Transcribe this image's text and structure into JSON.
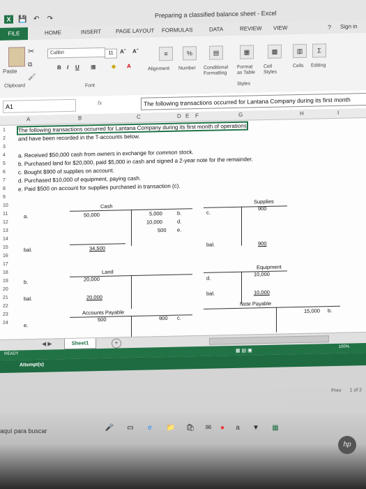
{
  "window": {
    "title": "Preparing a classified balance sheet - Excel",
    "help": "?"
  },
  "tabs": [
    "FILE",
    "HOME",
    "INSERT",
    "PAGE LAYOUT",
    "FORMULAS",
    "DATA",
    "REVIEW",
    "VIEW"
  ],
  "signin": "Sign in",
  "ribbon": {
    "paste": "Paste",
    "clipboard": "Clipboard",
    "font_name": "Calibri",
    "font_size": "11",
    "font_group": "Font",
    "bold": "B",
    "italic": "I",
    "underline": "U",
    "alignment": "Alignment",
    "number": "Number",
    "conditional": "Conditional Formatting",
    "format_table": "Format as Table",
    "cell_styles": "Cell Styles",
    "styles_group": "Styles",
    "cells": "Cells",
    "editing": "Editing"
  },
  "formula_bar": {
    "name_box": "A1",
    "fx": "fx",
    "content": "The following transactions occurred for Lantana Company during its first month"
  },
  "columns": [
    "A",
    "B",
    "C",
    "D",
    "E",
    "F",
    "G",
    "H",
    "I"
  ],
  "rows": [
    "1",
    "2",
    "3",
    "4",
    "5",
    "6",
    "7",
    "8",
    "9",
    "10",
    "11",
    "12",
    "13",
    "14",
    "15",
    "16",
    "17",
    "18",
    "19",
    "20",
    "21",
    "22",
    "23",
    "24"
  ],
  "sheet_text": {
    "r1": "The following transactions occurred for Lantana Company during its first month of operations",
    "r2": "and have been recorded in the T-accounts below.",
    "r4": "a. Received $50,000 cash from owners in exchange for common stock.",
    "r5": "b. Purchased land for $20,000, paid $5,000 in cash and signed a 2-year note for the remainder.",
    "r6": "c. Bought $900 of supplies on account.",
    "r7": "d. Purchased $10,000 of equipment, paying cash.",
    "r8": "e. Paid $500 on account for supplies purchased in transaction (c)."
  },
  "taccounts": {
    "cash_title": "Cash",
    "cash_a": "a.",
    "cash_debit": "50,000",
    "cash_credits": [
      "5,000",
      "10,000",
      "500"
    ],
    "cash_credit_keys": [
      "b.",
      "d.",
      "e."
    ],
    "cash_bal_lbl": "bal.",
    "cash_bal": "34,500",
    "supplies_title": "Supplies",
    "supplies_key": "c.",
    "supplies_val": "900",
    "supplies_bal_lbl": "bal.",
    "supplies_bal": "900",
    "land_title": "Land",
    "land_key": "b.",
    "land_val": "20,000",
    "land_bal_lbl": "bal.",
    "land_bal": "20,000",
    "equip_title": "Equipment",
    "equip_key": "d.",
    "equip_val": "10,000",
    "equip_bal_lbl": "bal.",
    "equip_bal": "10,000",
    "ap_title": "Accounts Payable",
    "ap_key": "e.",
    "ap_debit": "500",
    "ap_credit": "900",
    "ap_credit_key": "c.",
    "np_title": "Note Payable",
    "np_credit": "15,000",
    "np_key": "b."
  },
  "sheet_tab": "Sheet1",
  "sheet_add": "+",
  "status": "READY",
  "attempts": "Attempt(s)",
  "pager": "1 of 2",
  "prev": "Prev",
  "zoom": "100%",
  "taskbar": {
    "search": "aquí para buscar",
    "hp": "hp"
  },
  "colors": {
    "excel_green": "#217346",
    "ribbon_bg": "#f3f3f3"
  }
}
